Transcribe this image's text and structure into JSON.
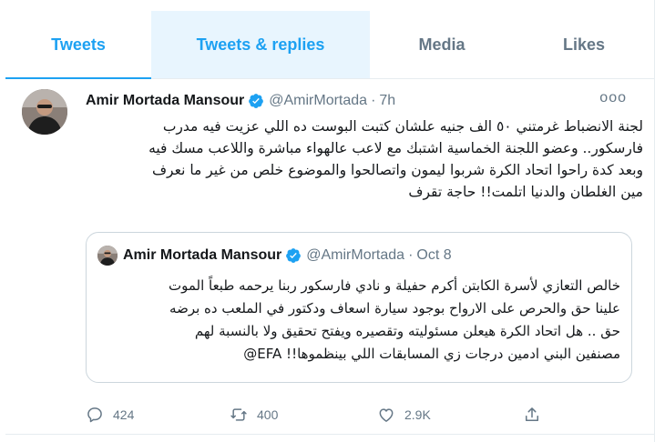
{
  "tabs": [
    {
      "label": "Tweets"
    },
    {
      "label": "Tweets & replies"
    },
    {
      "label": "Media"
    },
    {
      "label": "Likes"
    }
  ],
  "tweet": {
    "author_name": "Amir Mortada Mansour",
    "handle": "@AmirMortada",
    "separator": "·",
    "time": "7h",
    "more": "ooo",
    "text": "لجنة الانضباط غرمتني ٥٠ الف جنيه علشان كتبت البوست ده اللي عزيت فيه مدرب\nفارسكور.. وعضو اللجنة الخماسية اشتبك مع لاعب عالهواء مباشرة واللاعب مسك فيه\nوبعد كدة راحوا اتحاد الكرة شربوا ليمون واتصالحوا والموضوع خلص من غير ما نعرف\nمين الغلطان والدنيا اتلمت!! حاجة تقرف",
    "quoted": {
      "author_name": "Amir Mortada Mansour",
      "handle": "@AmirMortada",
      "separator": "·",
      "date": "Oct 8",
      "text": "خالص التعازي لأسرة الكابتن أكرم حفيلة و نادي فارسكور ربنا يرحمه طبعاً الموت\nعلينا حق والحرص على الارواح بوجود سيارة اسعاف ودكتور في الملعب ده برضه\nحق .. هل اتحاد الكرة هيعلن مسئوليته وتقصيره ويفتح تحقيق ولا بالنسبة لهم\nمصنفين البني ادمين درجات زي المسابقات اللي بينظموها!! EFA@"
    },
    "actions": {
      "reply_count": "424",
      "retweet_count": "400",
      "like_count": "2.9K"
    }
  },
  "colors": {
    "accent": "#1da1f2",
    "muted_text": "#657786",
    "border": "#e6ecf0",
    "tab_hover_bg": "#e8f5fe"
  },
  "icons": [
    "verified-badge-icon",
    "more-icon",
    "reply-icon",
    "retweet-icon",
    "like-icon",
    "share-icon"
  ]
}
